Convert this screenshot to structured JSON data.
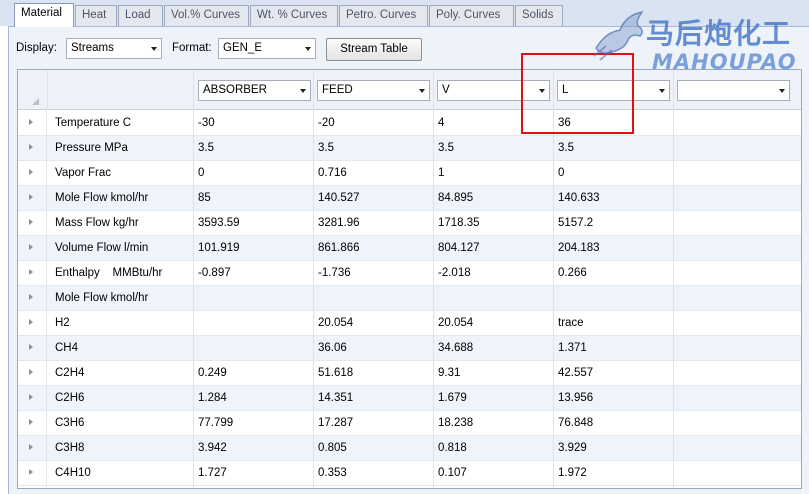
{
  "tabs": [
    {
      "label": "Material",
      "active": true
    },
    {
      "label": "Heat"
    },
    {
      "label": "Load"
    },
    {
      "label": "Vol.% Curves"
    },
    {
      "label": "Wt. % Curves"
    },
    {
      "label": "Petro. Curves"
    },
    {
      "label": "Poly. Curves"
    },
    {
      "label": "Solids"
    }
  ],
  "toolbar": {
    "display_label": "Display:",
    "display_value": "Streams",
    "format_label": "Format:",
    "format_value": "GEN_E",
    "stream_table_button": "Stream Table"
  },
  "columns": [
    "ABSORBER",
    "FEED",
    "V",
    "L",
    ""
  ],
  "rows": [
    {
      "name": "Temperature C",
      "values": [
        "-30",
        "-20",
        "4",
        "36"
      ]
    },
    {
      "name": "Pressure MPa",
      "values": [
        "3.5",
        "3.5",
        "3.5",
        "3.5"
      ]
    },
    {
      "name": "Vapor Frac",
      "values": [
        "0",
        "0.716",
        "1",
        "0"
      ]
    },
    {
      "name": "Mole Flow kmol/hr",
      "values": [
        "85",
        "140.527",
        "84.895",
        "140.633"
      ]
    },
    {
      "name": "Mass Flow kg/hr",
      "values": [
        "3593.59",
        "3281.96",
        "1718.35",
        "5157.2"
      ]
    },
    {
      "name": "Volume Flow l/min",
      "values": [
        "101.919",
        "861.866",
        "804.127",
        "204.183"
      ]
    },
    {
      "name": "Enthalpy    MMBtu/hr",
      "values": [
        "-0.897",
        "-1.736",
        "-2.018",
        "0.266"
      ]
    },
    {
      "name": "Mole Flow kmol/hr",
      "values": [
        "",
        "",
        "",
        ""
      ]
    },
    {
      "name": "H2",
      "values": [
        "",
        "20.054",
        "20.054",
        "trace"
      ]
    },
    {
      "name": "CH4",
      "values": [
        "",
        "36.06",
        "34.688",
        "1.371"
      ]
    },
    {
      "name": "C2H4",
      "values": [
        "0.249",
        "51.618",
        "9.31",
        "42.557"
      ]
    },
    {
      "name": "C2H6",
      "values": [
        "1.284",
        "14.351",
        "1.679",
        "13.956"
      ]
    },
    {
      "name": "C3H6",
      "values": [
        "77.799",
        "17.287",
        "18.238",
        "76.848"
      ]
    },
    {
      "name": "C3H8",
      "values": [
        "3.942",
        "0.805",
        "0.818",
        "3.929"
      ]
    },
    {
      "name": "C4H10",
      "values": [
        "1.727",
        "0.353",
        "0.107",
        "1.972"
      ]
    }
  ],
  "watermark": {
    "cn": "马后炮化工",
    "en": "MAHOUPAO"
  },
  "colors": {
    "highlight": "#e01010",
    "watermark": "#4676c8",
    "tab_bar": "#d9e3f1"
  }
}
